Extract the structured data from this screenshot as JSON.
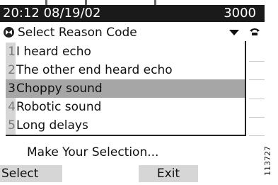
{
  "status_bar": {
    "time": "20:12 08/19/02",
    "extension": "3000"
  },
  "header": {
    "icon": "reason-code-icon",
    "title": "Select Reason Code",
    "arrow": "▼"
  },
  "line_icon": "phone-handset-icon",
  "menu": {
    "selected_index": 2,
    "items": [
      {
        "number": "1",
        "label": "I heard echo"
      },
      {
        "number": "2",
        "label": "The other end heard echo"
      },
      {
        "number": "3",
        "label": "Choppy sound"
      },
      {
        "number": "4",
        "label": "Robotic sound"
      },
      {
        "number": "5",
        "label": "Long delays"
      }
    ]
  },
  "prompt": "Make Your Selection...",
  "softkeys": {
    "select": "Select",
    "exit": "Exit"
  },
  "figure_id": "113727"
}
